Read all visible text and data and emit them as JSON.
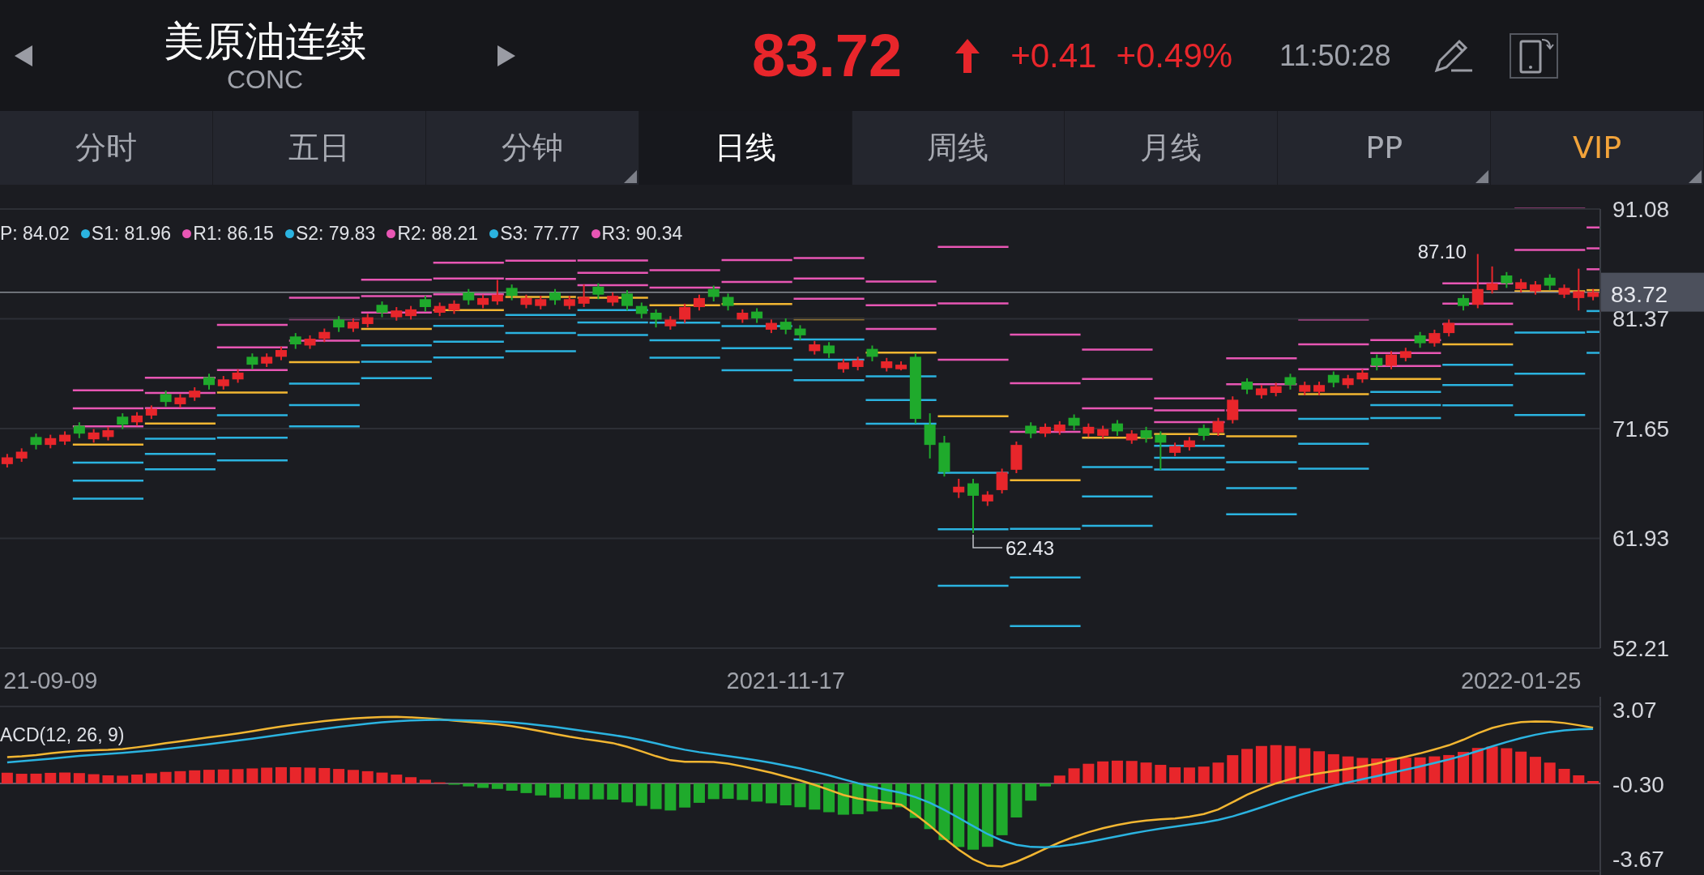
{
  "header": {
    "title": "美原油连续",
    "code": "CONC",
    "price": "83.72",
    "trend_up": true,
    "change": "+0.41",
    "change_percent": "+0.49%",
    "time": "11:50:28"
  },
  "tabs": [
    {
      "label": "分时",
      "selected": false,
      "has_menu": false,
      "kind": "normal"
    },
    {
      "label": "五日",
      "selected": false,
      "has_menu": false,
      "kind": "normal"
    },
    {
      "label": "分钟",
      "selected": false,
      "has_menu": true,
      "kind": "normal"
    },
    {
      "label": "日线",
      "selected": true,
      "has_menu": false,
      "kind": "normal"
    },
    {
      "label": "周线",
      "selected": false,
      "has_menu": false,
      "kind": "normal"
    },
    {
      "label": "月线",
      "selected": false,
      "has_menu": false,
      "kind": "normal"
    },
    {
      "label": "PP",
      "selected": false,
      "has_menu": true,
      "kind": "normal"
    },
    {
      "label": "VIP",
      "selected": false,
      "has_menu": true,
      "kind": "vip"
    }
  ],
  "pivot_legend": [
    {
      "label": "P: 84.02"
    },
    {
      "label": "S1: 81.96",
      "color": "#2bb3e0"
    },
    {
      "label": "R1: 86.15",
      "color": "#e856b4"
    },
    {
      "label": "S2: 79.83",
      "color": "#2bb3e0"
    },
    {
      "label": "R2: 88.21",
      "color": "#e856b4"
    },
    {
      "label": "S3: 77.77",
      "color": "#2bb3e0"
    },
    {
      "label": "R3: 90.34",
      "color": "#e856b4"
    }
  ],
  "price_chart": {
    "current_price": "83.72",
    "high_label": "87.10",
    "low_label": "62.43",
    "chart_data": {
      "type": "candlestick",
      "ylim": [
        52.21,
        91.08
      ],
      "grid": true,
      "yticks": [
        {
          "value": 91.08,
          "label": "91.08"
        },
        {
          "value": 81.37,
          "label": "81.37"
        },
        {
          "value": 71.65,
          "label": "71.65"
        },
        {
          "value": 61.93,
          "label": "61.93"
        },
        {
          "value": 52.21,
          "label": "52.21"
        }
      ],
      "categories": [
        null,
        null,
        null,
        "21-09-09",
        null,
        null,
        null,
        null,
        null,
        null,
        null,
        null,
        null,
        null,
        null,
        null,
        null,
        null,
        null,
        null,
        null,
        null,
        null,
        null,
        null,
        null,
        null,
        null,
        null,
        null,
        null,
        null,
        null,
        null,
        null,
        null,
        null,
        null,
        null,
        null,
        null,
        null,
        null,
        null,
        null,
        null,
        null,
        null,
        null,
        null,
        null,
        null,
        null,
        null,
        "2021-11-17",
        null,
        null,
        null,
        null,
        null,
        null,
        null,
        null,
        null,
        null,
        null,
        null,
        null,
        null,
        null,
        null,
        null,
        null,
        null,
        null,
        null,
        null,
        null,
        null,
        null,
        null,
        null,
        null,
        null,
        null,
        null,
        null,
        null,
        null,
        null,
        null,
        null,
        null,
        null,
        null,
        null,
        null,
        null,
        null,
        null,
        null,
        null,
        null,
        null,
        null,
        "2022-01-25",
        null,
        null,
        null,
        null,
        null
      ],
      "ohlc": [
        [
          68.5,
          69.4,
          68.2,
          69.1
        ],
        [
          69.0,
          69.9,
          68.7,
          69.6
        ],
        [
          70.9,
          71.2,
          69.8,
          70.2
        ],
        [
          70.2,
          71.1,
          69.9,
          70.8
        ],
        [
          70.5,
          71.4,
          70.2,
          71.1
        ],
        [
          71.9,
          72.2,
          70.8,
          71.2
        ],
        [
          70.7,
          71.6,
          70.4,
          71.3
        ],
        [
          70.9,
          71.8,
          70.6,
          71.5
        ],
        [
          72.7,
          73.0,
          71.6,
          72.0
        ],
        [
          72.2,
          73.1,
          71.9,
          72.8
        ],
        [
          72.8,
          73.7,
          72.5,
          73.4
        ],
        [
          74.7,
          75.0,
          73.6,
          74.0
        ],
        [
          73.8,
          74.7,
          73.5,
          74.4
        ],
        [
          74.4,
          75.3,
          74.1,
          75.0
        ],
        [
          76.2,
          76.5,
          75.1,
          75.5
        ],
        [
          75.4,
          76.3,
          75.1,
          76.0
        ],
        [
          76.0,
          76.9,
          75.7,
          76.6
        ],
        [
          78.0,
          78.3,
          76.9,
          77.3
        ],
        [
          77.4,
          78.3,
          77.1,
          78.0
        ],
        [
          78.0,
          78.9,
          77.7,
          78.6
        ],
        [
          79.8,
          80.1,
          78.7,
          79.1
        ],
        [
          79.0,
          79.9,
          78.7,
          79.6
        ],
        [
          79.6,
          80.5,
          79.3,
          80.2
        ],
        [
          81.3,
          81.6,
          80.2,
          80.6
        ],
        [
          80.5,
          81.4,
          80.2,
          81.1
        ],
        [
          80.9,
          81.8,
          80.6,
          81.5
        ],
        [
          82.6,
          82.9,
          81.5,
          81.9
        ],
        [
          81.5,
          82.4,
          81.2,
          82.1
        ],
        [
          81.6,
          82.5,
          81.3,
          82.2
        ],
        [
          83.1,
          83.4,
          82.0,
          82.4
        ],
        [
          81.9,
          82.8,
          81.6,
          82.5
        ],
        [
          82.1,
          83.0,
          81.8,
          82.7
        ],
        [
          83.7,
          84.0,
          82.6,
          83.0
        ],
        [
          82.6,
          83.5,
          82.3,
          83.2
        ],
        [
          82.9,
          84.8,
          82.6,
          83.5
        ],
        [
          84.1,
          84.4,
          83.0,
          83.4
        ],
        [
          82.6,
          83.5,
          82.3,
          83.2
        ],
        [
          82.5,
          83.4,
          82.2,
          83.1
        ],
        [
          83.7,
          84.0,
          82.6,
          83.0
        ],
        [
          82.5,
          83.4,
          82.2,
          83.1
        ],
        [
          82.7,
          84.4,
          82.4,
          83.3
        ],
        [
          84.2,
          84.5,
          83.1,
          83.5
        ],
        [
          82.8,
          83.7,
          82.5,
          83.4
        ],
        [
          83.6,
          83.9,
          82.1,
          82.5
        ],
        [
          82.5,
          82.8,
          81.4,
          81.8
        ],
        [
          81.9,
          82.2,
          80.6,
          81.3
        ],
        [
          80.7,
          81.6,
          80.4,
          81.3
        ],
        [
          81.3,
          82.7,
          81.0,
          82.4
        ],
        [
          82.4,
          83.5,
          82.1,
          83.2
        ],
        [
          84.0,
          84.3,
          82.9,
          83.3
        ],
        [
          83.3,
          83.6,
          82.1,
          82.5
        ],
        [
          81.3,
          82.2,
          81.0,
          81.9
        ],
        [
          82.0,
          82.3,
          81.0,
          81.4
        ],
        [
          80.4,
          81.3,
          80.1,
          81.0
        ],
        [
          81.1,
          81.4,
          80.0,
          80.4
        ],
        [
          80.5,
          80.8,
          79.5,
          79.9
        ],
        [
          78.5,
          79.4,
          78.2,
          79.1
        ],
        [
          79.0,
          79.3,
          77.9,
          78.3
        ],
        [
          76.9,
          77.8,
          76.6,
          77.5
        ],
        [
          77.1,
          78.0,
          76.8,
          77.7
        ],
        [
          78.7,
          79.0,
          77.6,
          78.0
        ],
        [
          77.0,
          77.9,
          76.7,
          77.6
        ],
        [
          76.9,
          77.6,
          76.8,
          77.3
        ],
        [
          78.0,
          78.3,
          72.1,
          72.5
        ],
        [
          72.0,
          73.0,
          69.0,
          70.2
        ],
        [
          70.4,
          71.0,
          67.4,
          67.8
        ],
        [
          66.0,
          67.2,
          65.5,
          66.5
        ],
        [
          66.8,
          67.2,
          62.4,
          65.7
        ],
        [
          65.2,
          66.1,
          64.8,
          65.8
        ],
        [
          66.2,
          68.1,
          65.9,
          67.8
        ],
        [
          68.0,
          70.5,
          67.7,
          70.2
        ],
        [
          71.9,
          72.2,
          70.8,
          71.2
        ],
        [
          71.2,
          72.1,
          70.9,
          71.8
        ],
        [
          71.4,
          72.3,
          71.1,
          72.0
        ],
        [
          72.6,
          72.9,
          71.5,
          71.9
        ],
        [
          71.2,
          72.1,
          70.9,
          71.8
        ],
        [
          71.0,
          71.9,
          70.7,
          71.6
        ],
        [
          72.1,
          72.4,
          71.0,
          71.4
        ],
        [
          70.6,
          71.5,
          70.3,
          71.2
        ],
        [
          71.5,
          71.8,
          70.4,
          70.8
        ],
        [
          71.1,
          71.4,
          68.0,
          70.4
        ],
        [
          69.5,
          70.4,
          69.2,
          70.1
        ],
        [
          70.0,
          70.9,
          69.7,
          70.6
        ],
        [
          71.7,
          72.0,
          70.6,
          71.0
        ],
        [
          71.3,
          72.6,
          71.0,
          72.3
        ],
        [
          72.4,
          74.5,
          72.1,
          74.2
        ],
        [
          75.8,
          76.1,
          74.7,
          75.1
        ],
        [
          74.6,
          75.5,
          74.3,
          75.2
        ],
        [
          74.8,
          75.7,
          74.5,
          75.4
        ],
        [
          76.2,
          76.5,
          75.1,
          75.5
        ],
        [
          74.9,
          75.8,
          74.6,
          75.5
        ],
        [
          74.9,
          75.8,
          74.6,
          75.5
        ],
        [
          76.4,
          76.7,
          75.3,
          75.7
        ],
        [
          75.5,
          76.4,
          75.2,
          76.1
        ],
        [
          76.0,
          76.9,
          75.7,
          76.6
        ],
        [
          77.9,
          78.2,
          76.8,
          77.2
        ],
        [
          77.2,
          78.5,
          76.9,
          78.2
        ],
        [
          77.9,
          78.8,
          77.6,
          78.5
        ],
        [
          79.9,
          80.2,
          78.8,
          79.2
        ],
        [
          79.2,
          80.4,
          78.9,
          80.1
        ],
        [
          80.1,
          81.3,
          79.8,
          81.0
        ],
        [
          83.2,
          83.5,
          82.1,
          82.5
        ],
        [
          82.6,
          87.1,
          82.3,
          84.0
        ],
        [
          83.9,
          86.0,
          83.6,
          84.5
        ],
        [
          85.2,
          85.5,
          84.1,
          84.5
        ],
        [
          84.0,
          84.9,
          83.7,
          84.6
        ],
        [
          83.8,
          84.7,
          83.5,
          84.4
        ],
        [
          85.0,
          85.3,
          83.9,
          84.3
        ],
        [
          83.5,
          84.4,
          83.2,
          84.1
        ],
        [
          83.2,
          85.8,
          82.1,
          83.8
        ],
        [
          83.3,
          84.0,
          83.0,
          83.72
        ]
      ]
    }
  },
  "macd": {
    "label": "ACD(12, 26, 9)",
    "axis": [
      "3.07",
      "-0.30",
      "-3.67"
    ]
  }
}
